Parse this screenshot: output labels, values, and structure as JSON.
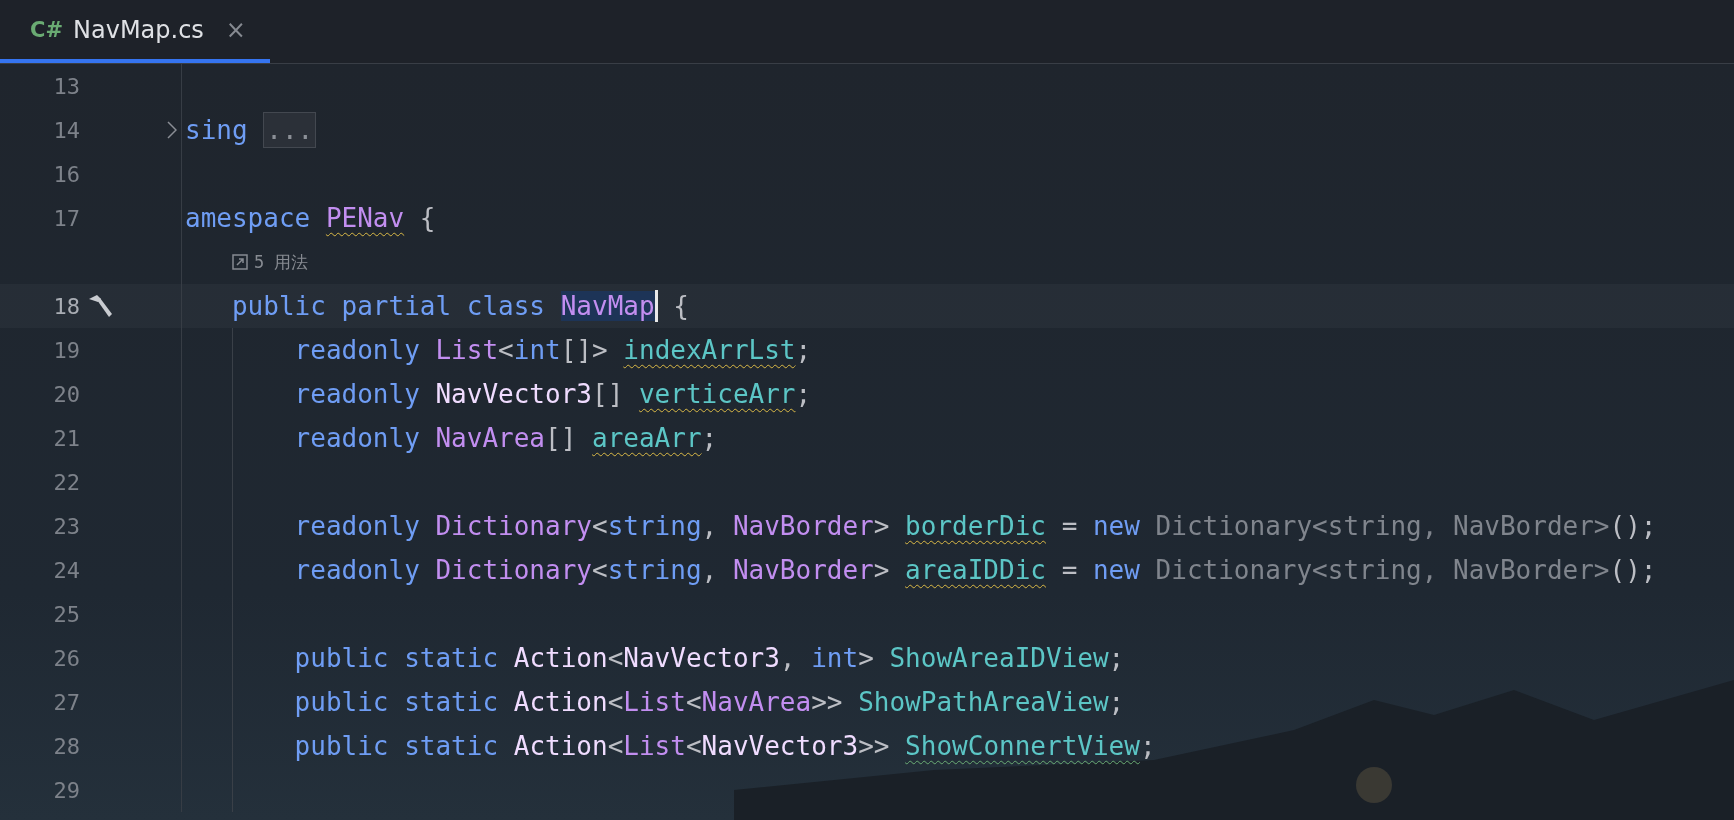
{
  "tabs": [
    {
      "language": "C#",
      "label": "NavMap.cs",
      "close": "×",
      "selected": true
    }
  ],
  "lines": [
    {
      "kind": "code",
      "number": "13"
    },
    {
      "kind": "code",
      "number": "14",
      "foldable": true,
      "tokens": [
        {
          "text": "sing ",
          "kind": "keyword"
        },
        {
          "text": "...",
          "kind": "fold"
        }
      ]
    },
    {
      "kind": "code",
      "number": "16"
    },
    {
      "kind": "code",
      "number": "17",
      "tokens": [
        {
          "text": "amespace ",
          "kind": "keyword"
        },
        {
          "text": "PENav",
          "kind": "type",
          "warning": true
        },
        {
          "text": " {",
          "kind": "plain"
        }
      ]
    },
    {
      "kind": "hint",
      "text": "5 用法"
    },
    {
      "kind": "code",
      "number": "18",
      "current": true,
      "build_marker": true,
      "tokens": [
        {
          "text": "   public partial class ",
          "kind": "keyword"
        },
        {
          "text": "NavMap",
          "kind": "type",
          "selected": true
        },
        {
          "text": " {",
          "kind": "plain"
        }
      ]
    },
    {
      "kind": "code",
      "number": "19",
      "indent_guide": true,
      "tokens": [
        {
          "text": "       readonly ",
          "kind": "keyword"
        },
        {
          "text": "List",
          "kind": "type"
        },
        {
          "text": "<",
          "kind": "plain"
        },
        {
          "text": "int",
          "kind": "keyword"
        },
        {
          "text": "[]> ",
          "kind": "plain"
        },
        {
          "text": "indexArrLst",
          "kind": "field",
          "warning": true
        },
        {
          "text": ";",
          "kind": "plain"
        }
      ]
    },
    {
      "kind": "code",
      "number": "20",
      "indent_guide": true,
      "tokens": [
        {
          "text": "       readonly ",
          "kind": "keyword"
        },
        {
          "text": "NavVector3",
          "kind": "struct"
        },
        {
          "text": "[] ",
          "kind": "plain"
        },
        {
          "text": "verticeArr",
          "kind": "field",
          "warning": true
        },
        {
          "text": ";",
          "kind": "plain"
        }
      ]
    },
    {
      "kind": "code",
      "number": "21",
      "indent_guide": true,
      "tokens": [
        {
          "text": "       readonly ",
          "kind": "keyword"
        },
        {
          "text": "NavArea",
          "kind": "type"
        },
        {
          "text": "[] ",
          "kind": "plain"
        },
        {
          "text": "areaArr",
          "kind": "field",
          "warning": true
        },
        {
          "text": ";",
          "kind": "plain"
        }
      ]
    },
    {
      "kind": "code",
      "number": "22",
      "indent_guide": true
    },
    {
      "kind": "code",
      "number": "23",
      "indent_guide": true,
      "tokens": [
        {
          "text": "       readonly ",
          "kind": "keyword"
        },
        {
          "text": "Dictionary",
          "kind": "type"
        },
        {
          "text": "<",
          "kind": "plain"
        },
        {
          "text": "string",
          "kind": "keyword"
        },
        {
          "text": ", ",
          "kind": "plain"
        },
        {
          "text": "NavBorder",
          "kind": "type"
        },
        {
          "text": "> ",
          "kind": "plain"
        },
        {
          "text": "borderDic",
          "kind": "field",
          "warning": true
        },
        {
          "text": " = ",
          "kind": "plain"
        },
        {
          "text": "new ",
          "kind": "keyword"
        },
        {
          "text": "Dictionary<string, NavBorder>",
          "kind": "dim"
        },
        {
          "text": "();",
          "kind": "plain"
        }
      ]
    },
    {
      "kind": "code",
      "number": "24",
      "indent_guide": true,
      "tokens": [
        {
          "text": "       readonly ",
          "kind": "keyword"
        },
        {
          "text": "Dictionary",
          "kind": "type"
        },
        {
          "text": "<",
          "kind": "plain"
        },
        {
          "text": "string",
          "kind": "keyword"
        },
        {
          "text": ", ",
          "kind": "plain"
        },
        {
          "text": "NavBorder",
          "kind": "type"
        },
        {
          "text": "> ",
          "kind": "plain"
        },
        {
          "text": "areaIDDic",
          "kind": "field",
          "warning": true
        },
        {
          "text": " = ",
          "kind": "plain"
        },
        {
          "text": "new ",
          "kind": "keyword"
        },
        {
          "text": "Dictionary<string, NavBorder>",
          "kind": "dim"
        },
        {
          "text": "();",
          "kind": "plain"
        }
      ]
    },
    {
      "kind": "code",
      "number": "25",
      "indent_guide": true
    },
    {
      "kind": "code",
      "number": "26",
      "indent_guide": true,
      "tokens": [
        {
          "text": "       public static ",
          "kind": "keyword"
        },
        {
          "text": "Action",
          "kind": "struct"
        },
        {
          "text": "<",
          "kind": "plain"
        },
        {
          "text": "NavVector3",
          "kind": "struct"
        },
        {
          "text": ", ",
          "kind": "plain"
        },
        {
          "text": "int",
          "kind": "keyword"
        },
        {
          "text": "> ",
          "kind": "plain"
        },
        {
          "text": "ShowAreaIDView",
          "kind": "field"
        },
        {
          "text": ";",
          "kind": "plain"
        }
      ]
    },
    {
      "kind": "code",
      "number": "27",
      "indent_guide": true,
      "tokens": [
        {
          "text": "       public static ",
          "kind": "keyword"
        },
        {
          "text": "Action",
          "kind": "struct"
        },
        {
          "text": "<",
          "kind": "plain"
        },
        {
          "text": "List",
          "kind": "type"
        },
        {
          "text": "<",
          "kind": "plain"
        },
        {
          "text": "NavArea",
          "kind": "type"
        },
        {
          "text": ">> ",
          "kind": "plain"
        },
        {
          "text": "ShowPathAreaView",
          "kind": "field"
        },
        {
          "text": ";",
          "kind": "plain"
        }
      ]
    },
    {
      "kind": "code",
      "number": "28",
      "indent_guide": true,
      "tokens": [
        {
          "text": "       public static ",
          "kind": "keyword"
        },
        {
          "text": "Action",
          "kind": "struct"
        },
        {
          "text": "<",
          "kind": "plain"
        },
        {
          "text": "List",
          "kind": "type"
        },
        {
          "text": "<",
          "kind": "plain"
        },
        {
          "text": "NavVector3",
          "kind": "struct"
        },
        {
          "text": ">> ",
          "kind": "plain"
        },
        {
          "text": "ShowConnertView",
          "kind": "field",
          "typo": true
        },
        {
          "text": ";",
          "kind": "plain"
        }
      ]
    },
    {
      "kind": "code",
      "number": "29",
      "indent_guide": true
    }
  ]
}
